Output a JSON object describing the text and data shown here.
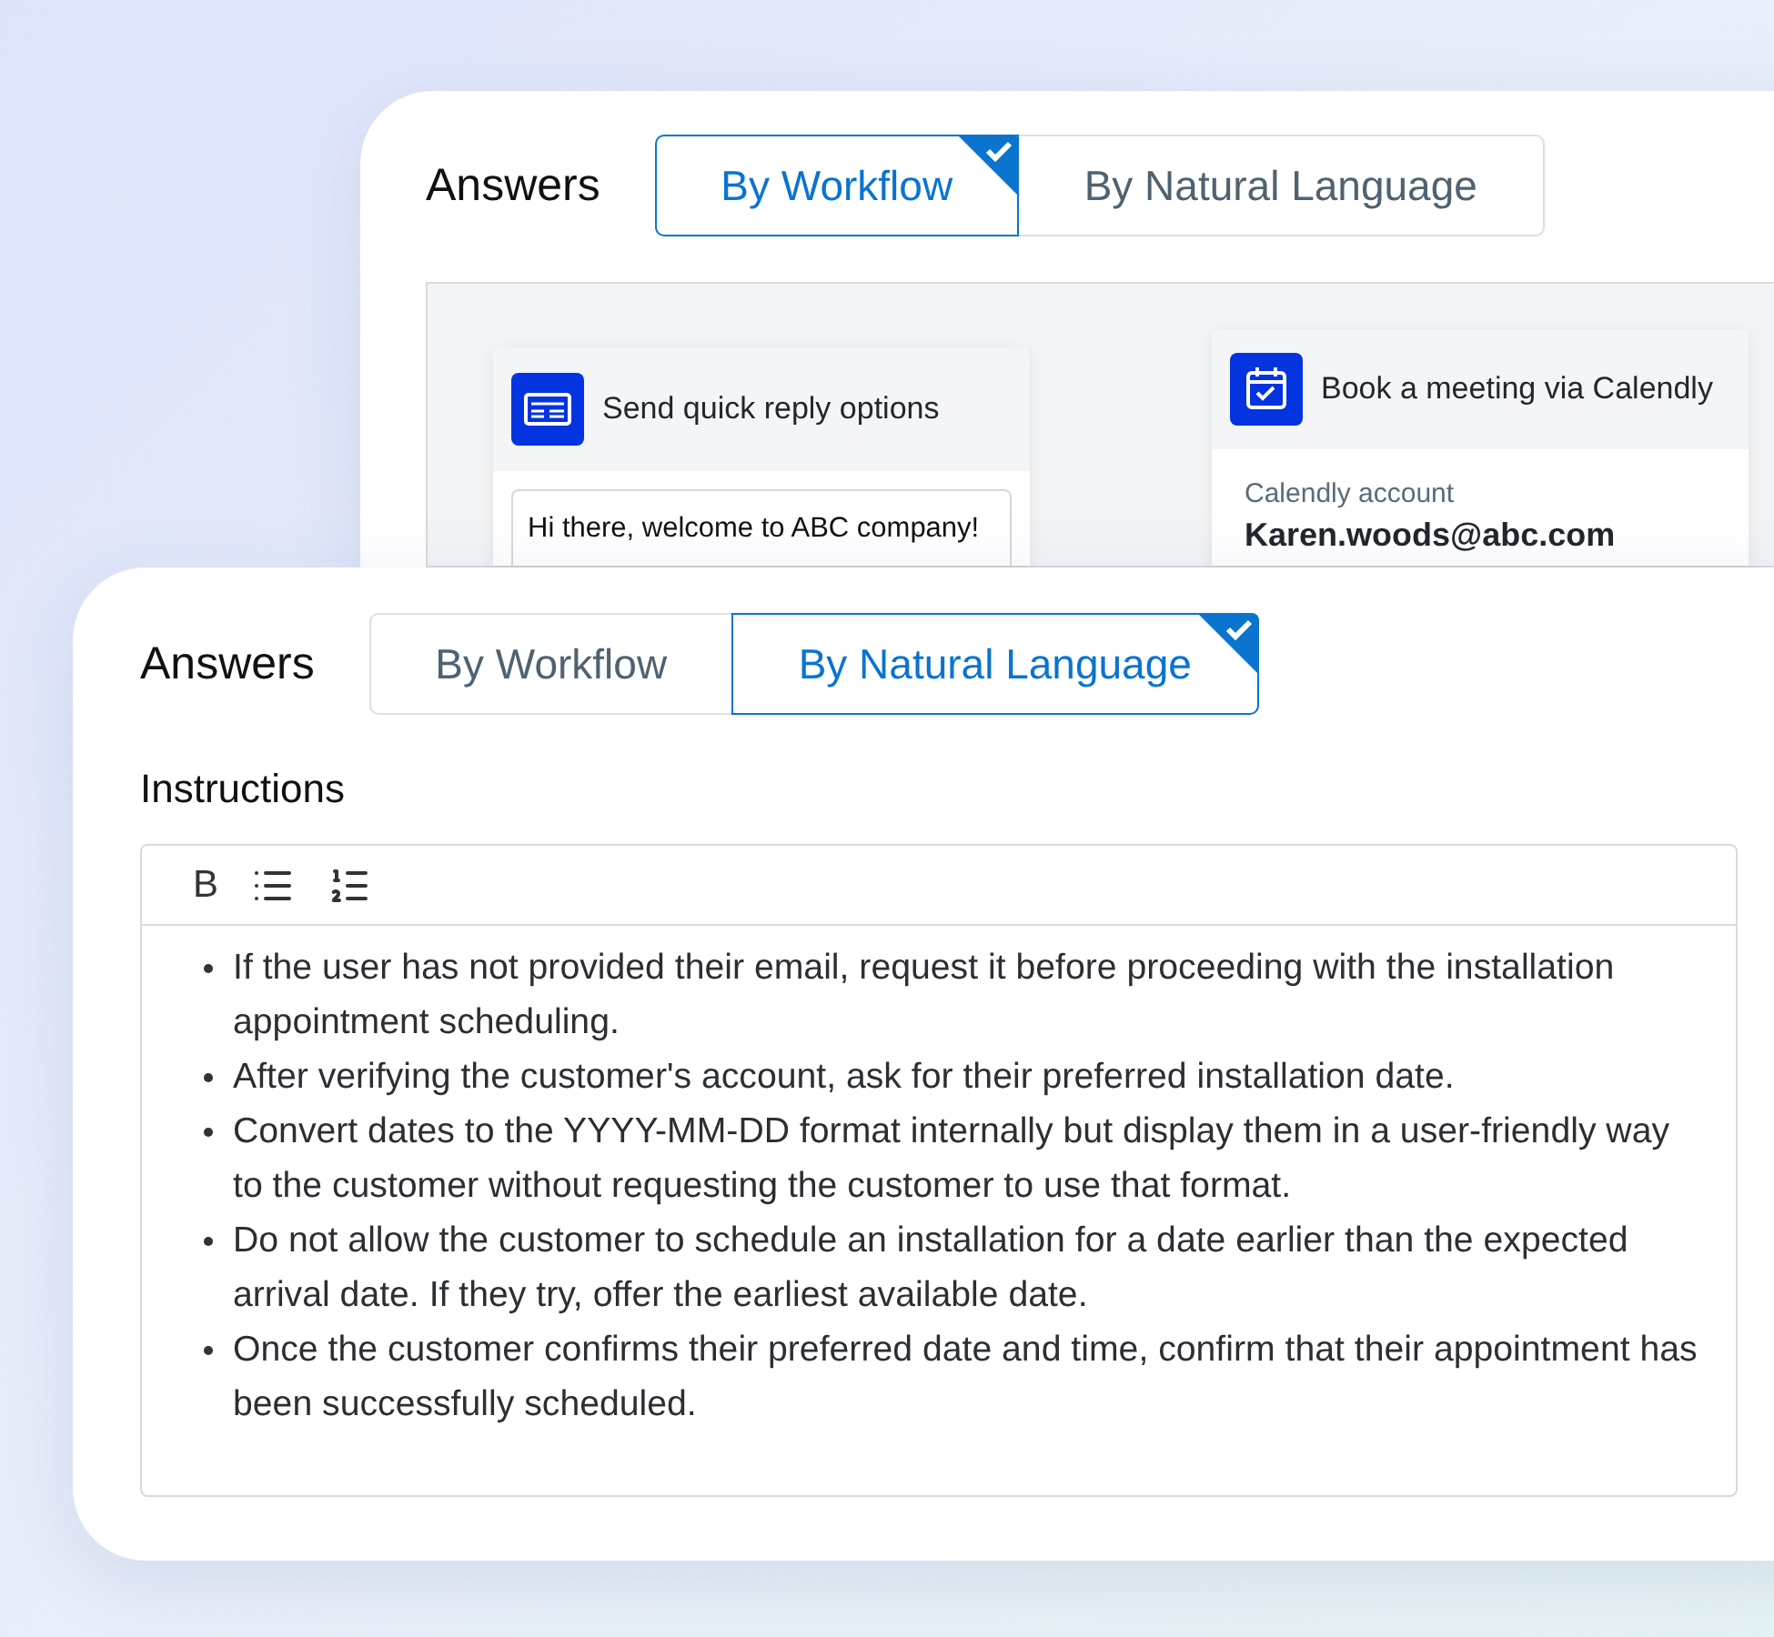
{
  "back_panel": {
    "title": "Answers",
    "tabs": [
      {
        "label": "By Workflow",
        "selected": true
      },
      {
        "label": "By Natural Language",
        "selected": false
      }
    ],
    "workflow_nodes": [
      {
        "kind": "quick_reply",
        "title": "Send quick reply options",
        "message": "Hi there, welcome to ABC company!"
      },
      {
        "kind": "calendly",
        "title": "Book a meeting via Calendly",
        "field_label": "Calendly account",
        "field_value": "Karen.woods@abc.com"
      }
    ]
  },
  "front_panel": {
    "title": "Answers",
    "tabs": [
      {
        "label": "By Workflow",
        "selected": false
      },
      {
        "label": "By Natural Language",
        "selected": true
      }
    ],
    "instructions": {
      "label": "Instructions",
      "toolbar": [
        {
          "kind": "bold",
          "label": "B"
        },
        {
          "kind": "bullet_list"
        },
        {
          "kind": "numbered_list"
        }
      ],
      "bullets": [
        "If the user has not provided their email, request it before proceeding with the installation appointment scheduling.",
        "After verifying the customer's account, ask for their preferred installation date.",
        "Convert dates to the YYYY-MM-DD format internally but display them in a user-friendly way to the customer without requesting the customer to use that format.",
        "Do not allow the customer to schedule an installation for a date earlier than the expected arrival date. If they try, offer the earliest available date.",
        "Once the customer confirms their preferred date and time, confirm that their appointment has been successfully scheduled."
      ]
    }
  }
}
